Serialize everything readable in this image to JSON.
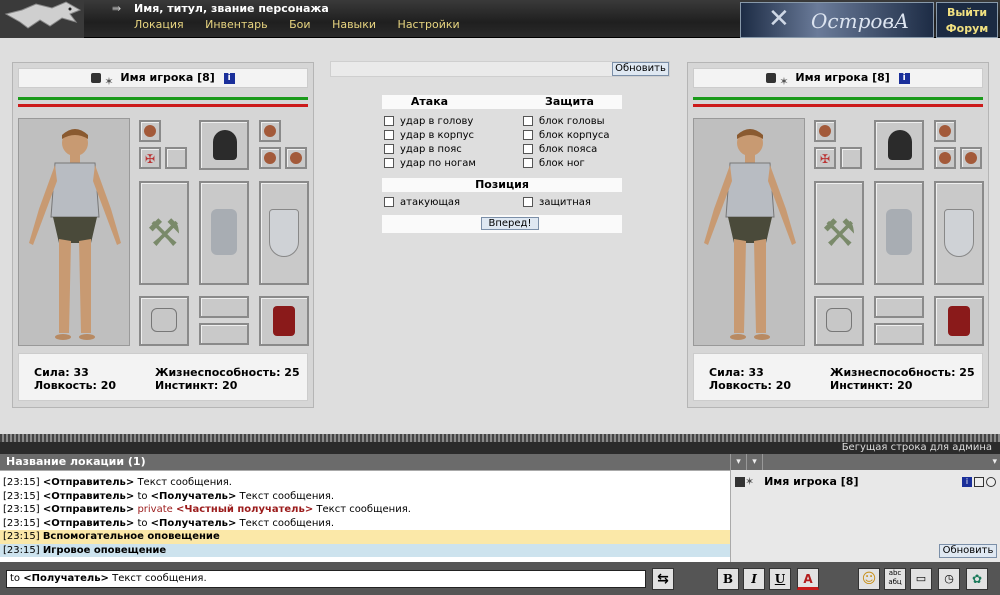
{
  "header": {
    "character_title": "Имя, титул, звание персонажа",
    "nav": [
      "Локация",
      "Инвентарь",
      "Бои",
      "Навыки",
      "Настройки"
    ],
    "brand": "ОстровА",
    "exit_label": "Выйти",
    "forum_label": "Форум"
  },
  "player_left": {
    "name": "Имя игрока [8]",
    "stats": {
      "strength": "Сила: 33",
      "agility": "Ловкость: 20",
      "vitality": "Жизнеспособность: 25",
      "instinct": "Инстинкт: 20"
    },
    "hp_fraction": 1.0,
    "mp_fraction": 1.0
  },
  "player_right": {
    "name": "Имя игрока [8]",
    "stats": {
      "strength": "Сила: 33",
      "agility": "Ловкость: 20",
      "vitality": "Жизнеспособность: 25",
      "instinct": "Инстинкт: 20"
    },
    "hp_fraction": 1.0,
    "mp_fraction": 1.0
  },
  "battle": {
    "refresh_label": "Обновить",
    "attack_header": "Атака",
    "defense_header": "Защита",
    "attack_options": [
      "удар в голову",
      "удар в корпус",
      "удар в пояс",
      "удар по ногам"
    ],
    "defense_options": [
      "блок головы",
      "блок корпуса",
      "блок пояса",
      "блок ног"
    ],
    "position_header": "Позиция",
    "position_options": [
      "атакующая",
      "защитная"
    ],
    "submit_label": "Вперед!"
  },
  "ticker": "Бегущая строка для админа",
  "chat": {
    "location_title": "Название локации (1)",
    "messages": [
      {
        "time": "[23:15]",
        "sender": "<Отправитель>",
        "kind": "public",
        "prefix": "",
        "recipient": "",
        "text": "Текст сообщения."
      },
      {
        "time": "[23:15]",
        "sender": "<Отправитель>",
        "kind": "to",
        "prefix": "to",
        "recipient": "<Получатель>",
        "text": "Текст сообщения."
      },
      {
        "time": "[23:15]",
        "sender": "<Отправитель>",
        "kind": "private",
        "prefix": "private",
        "recipient": "<Частный получатель>",
        "text": "Текст сообщения."
      },
      {
        "time": "[23:15]",
        "sender": "<Отправитель>",
        "kind": "to",
        "prefix": "to",
        "recipient": "<Получатель>",
        "text": "Текст сообщения."
      },
      {
        "time": "[23:15]",
        "kind": "helper",
        "text": "Вспомогательное оповещение"
      },
      {
        "time": "[23:15]",
        "kind": "game",
        "text": "Игровое оповещение"
      }
    ],
    "user_list": [
      {
        "name": "Имя игрока [8]"
      }
    ],
    "users_refresh_label": "Обновить",
    "input": {
      "prefix": "to",
      "recipient": "<Получатель>",
      "text": "Текст сообщения."
    }
  },
  "toolbar": {
    "bold": "B",
    "italic": "I",
    "underline": "U",
    "color": "A",
    "translit": "abc\nабц"
  },
  "colors": {
    "hp": "#1a9a1a",
    "mp": "#cc1a1a",
    "helper_bg": "#fbe8a8",
    "game_bg": "#cde3ee",
    "private": "#9b1b1b",
    "accent_nav": "#e8d580"
  }
}
